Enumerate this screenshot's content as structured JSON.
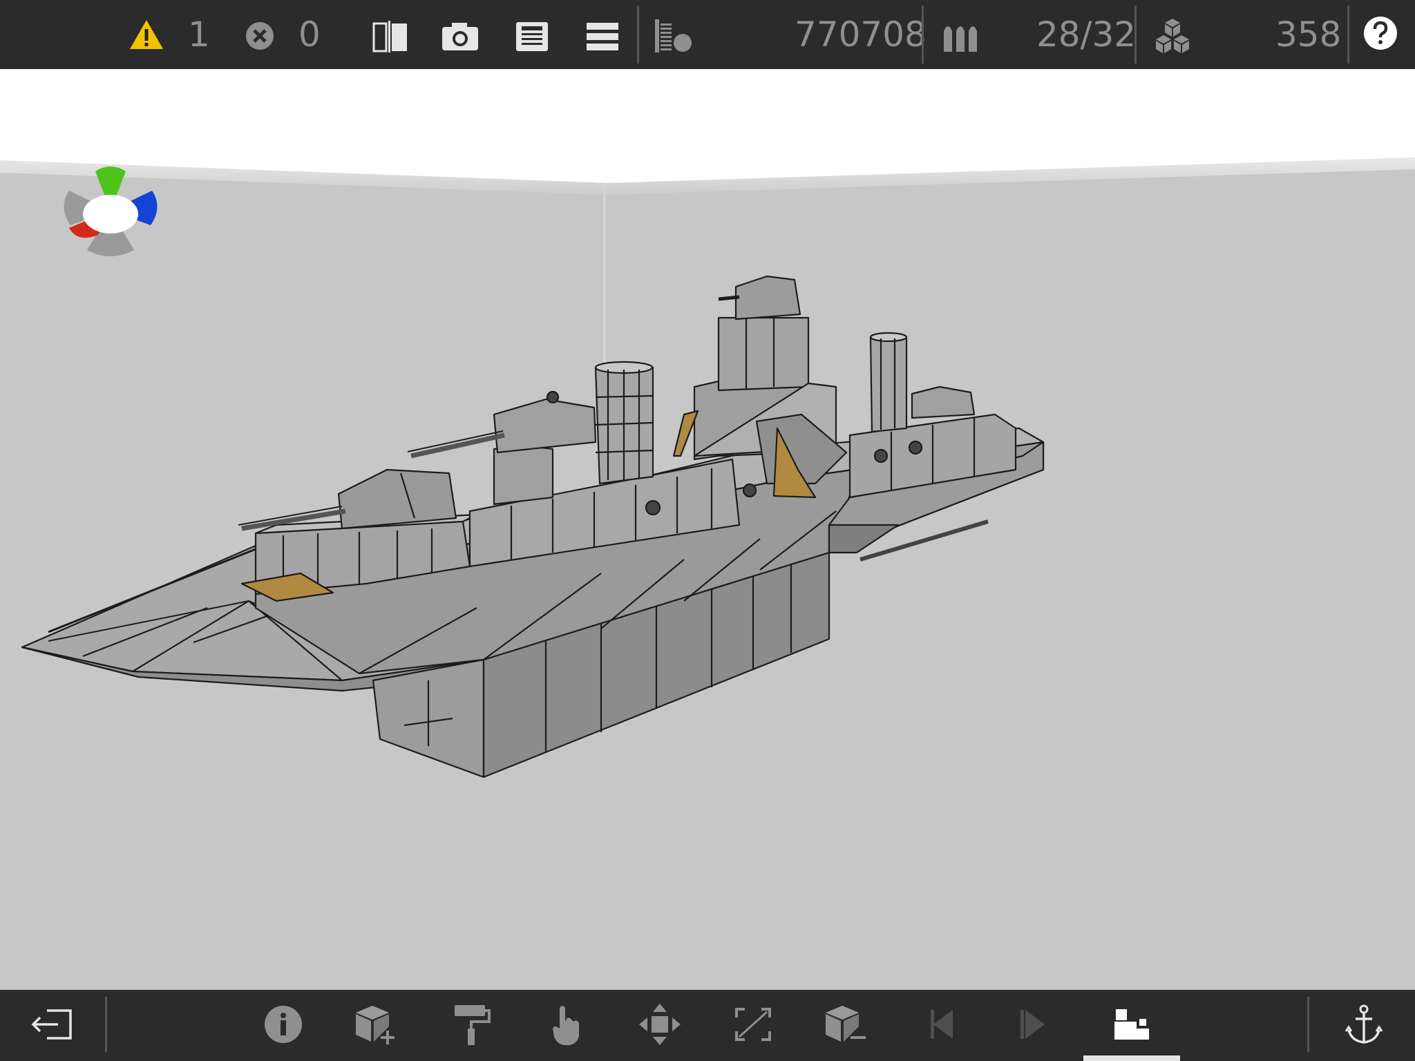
{
  "topbar": {
    "warnings_count": "1",
    "errors_count": "0",
    "cost": "770708",
    "weapons": "28/32",
    "blocks": "358"
  },
  "colors": {
    "bar_bg": "#2b2b2b",
    "icon": "#e6e6e6",
    "dim_text": "#8f8f8f",
    "warning": "#f2c200",
    "axis_x": "#d42a1c",
    "axis_y": "#4cc41a",
    "axis_z": "#1444d4",
    "hull": "#8a8a8a",
    "accent_plate": "#b08a40"
  },
  "icons": {
    "top": [
      "warning-icon",
      "error-icon",
      "mirror-icon",
      "camera-icon",
      "save-icon",
      "menu-icon",
      "stats-icon",
      "ammo-icon",
      "blocks-icon",
      "help-icon"
    ],
    "bottom": [
      "exit-icon",
      "info-icon",
      "add-block-icon",
      "paint-icon",
      "select-icon",
      "move-icon",
      "resize-icon",
      "remove-block-icon",
      "previous-icon",
      "next-icon",
      "build-mode-icon",
      "anchor-icon"
    ]
  }
}
